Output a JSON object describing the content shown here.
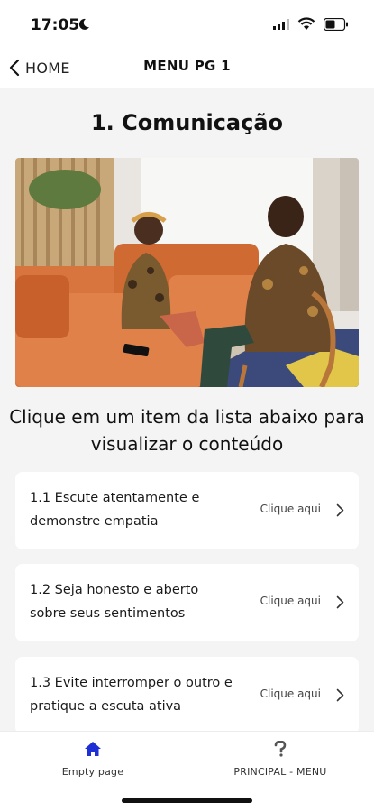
{
  "status": {
    "time": "17:05"
  },
  "nav": {
    "back_label": "HOME",
    "title": "MENU PG 1"
  },
  "page": {
    "title": "1. Comunicação",
    "instruction": "Clique em um item da lista abaixo para visualizar o conteúdo"
  },
  "items": [
    {
      "label": "1.1 Escute atentamente e demonstre empatia",
      "action": "Clique aqui"
    },
    {
      "label": "1.2 Seja honesto e aberto sobre seus sentimentos",
      "action": "Clique aqui"
    },
    {
      "label": "1.3 Evite interromper o outro e pratique a escuta ativa",
      "action": "Clique aqui"
    }
  ],
  "tabs": [
    {
      "label": "Empty page",
      "icon": "home-icon"
    },
    {
      "label": "PRINCIPAL - MENU",
      "icon": "question-icon"
    }
  ],
  "colors": {
    "accent": "#1f2fd6",
    "background": "#f4f4f4",
    "card": "#ffffff",
    "sofa": "#d8743d"
  }
}
